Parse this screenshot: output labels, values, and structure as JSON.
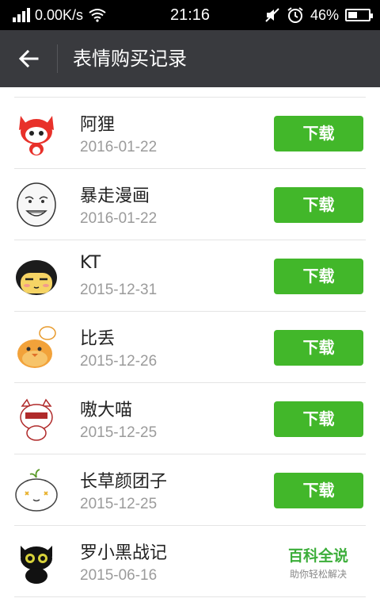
{
  "status_bar": {
    "net_speed": "0.00K/s",
    "time": "21:16",
    "battery_percent": "46%",
    "battery_level": 0.46,
    "icons": [
      "signal-icon",
      "wifi-icon",
      "mute-icon",
      "alarm-icon",
      "battery-icon"
    ]
  },
  "header": {
    "back_icon": "back-arrow-icon",
    "title": "表情购买记录"
  },
  "records": [
    {
      "name": "阿狸",
      "date": "2016-01-22",
      "button": "下载",
      "icon": "ahri-fox-sticker"
    },
    {
      "name": "暴走漫画",
      "date": "2016-01-22",
      "button": "下载",
      "icon": "rage-face-sticker"
    },
    {
      "name": "KT",
      "date": "2015-12-31",
      "button": "下载",
      "icon": "kt-girl-sticker"
    },
    {
      "name": "比丢",
      "date": "2015-12-26",
      "button": "下载",
      "icon": "bidiu-chick-sticker"
    },
    {
      "name": "嗷大喵",
      "date": "2015-12-25",
      "button": "下载",
      "icon": "aodamiao-cat-sticker"
    },
    {
      "name": "长草颜团子",
      "date": "2015-12-25",
      "button": "下载",
      "icon": "changcao-dumpling-sticker"
    },
    {
      "name": "罗小黑战记",
      "date": "2015-06-16",
      "button": "",
      "icon": "luoxiaohei-cat-sticker"
    }
  ],
  "watermark": {
    "title": "百科全说",
    "subtitle": "助你轻松解决"
  },
  "colors": {
    "header_bg": "#393a3e",
    "accent_green": "#42b72a",
    "date_gray": "#9b9b9b"
  }
}
